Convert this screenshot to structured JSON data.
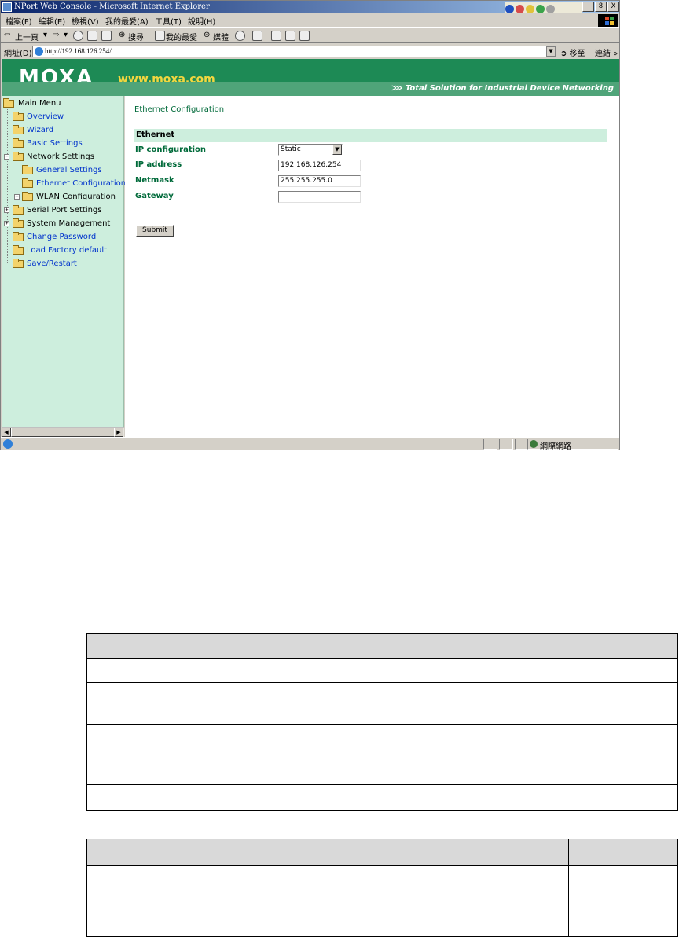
{
  "browser": {
    "title": "NPort Web Console - Microsoft Internet Explorer",
    "menu": [
      "檔案(F)",
      "編輯(E)",
      "檢視(V)",
      "我的最愛(A)",
      "工具(T)",
      "說明(H)"
    ],
    "toolbar": {
      "back": "上一頁",
      "search": "搜尋",
      "favorites": "我的最愛",
      "media": "媒體"
    },
    "address_label": "網址(D)",
    "address": "http://192.168.126.254/",
    "go": "移至",
    "links": "連結",
    "window_buttons": [
      "_",
      "8",
      "X"
    ],
    "status_zone": "網際網路"
  },
  "banner": {
    "logo": "MOXA",
    "site": "www.moxa.com",
    "tagline": "Total Solution for Industrial Device Networking",
    "colors": {
      "green": "#1d8a55",
      "stripe": "#4fa479",
      "site_text": "#f2d640"
    }
  },
  "nav": {
    "root": "Main Menu",
    "items": [
      {
        "label": "Overview"
      },
      {
        "label": "Wizard"
      },
      {
        "label": "Basic Settings"
      },
      {
        "label": "Network Settings"
      },
      {
        "label": "General Settings"
      },
      {
        "label": "Ethernet Configuration"
      },
      {
        "label": "WLAN Configuration"
      },
      {
        "label": "Serial Port Settings"
      },
      {
        "label": "System Management"
      },
      {
        "label": "Change Password"
      },
      {
        "label": "Load Factory default"
      },
      {
        "label": "Save/Restart"
      }
    ]
  },
  "content": {
    "page_title": "Ethernet Configuration",
    "section": "Ethernet",
    "fields": {
      "ip_config": {
        "label": "IP configuration",
        "value": "Static"
      },
      "ip_address": {
        "label": "IP address",
        "value": "192.168.126.254"
      },
      "netmask": {
        "label": "Netmask",
        "value": "255.255.255.0"
      },
      "gateway": {
        "label": "Gateway",
        "value": ""
      }
    },
    "submit": "Submit"
  }
}
